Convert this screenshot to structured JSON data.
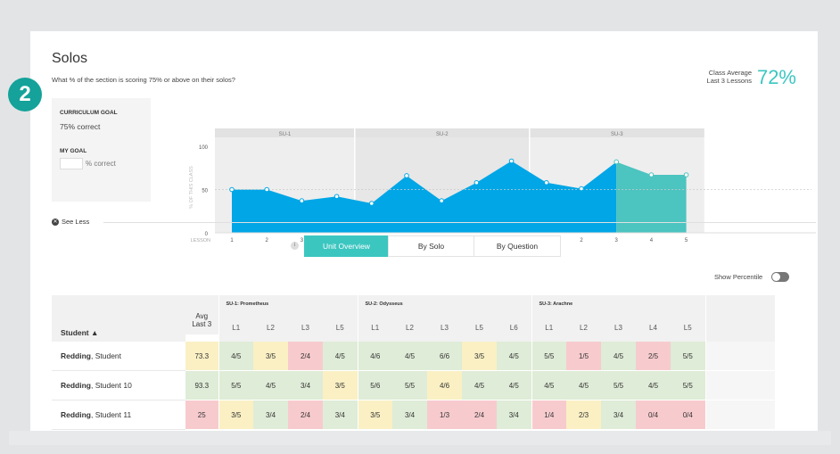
{
  "header": {
    "title": "Solos",
    "subtitle": "What % of the section is scoring 75% or above on their solos?",
    "class_average_line1": "Class Average",
    "class_average_line2": "Last 3 Lessons",
    "class_average_value": "72%"
  },
  "step_badge": "2",
  "goals": {
    "curriculum_goal_title": "CURRICULUM GOAL",
    "curriculum_goal_value": "75% correct",
    "my_goal_title": "MY GOAL",
    "my_goal_value": "",
    "my_goal_suffix": "% correct"
  },
  "chart_data": {
    "type": "area",
    "ylabel": "% OF THIS CLASS",
    "xlabel": "LESSON",
    "ylim": [
      0,
      100
    ],
    "yticks": [
      "100",
      "50",
      "0"
    ],
    "goal_line": 50,
    "units": [
      {
        "name": "SU-1",
        "lessons": [
          "1",
          "2",
          "3",
          "5"
        ],
        "values": [
          50,
          50,
          37,
          42
        ]
      },
      {
        "name": "SU-2",
        "lessons": [
          "1",
          "2",
          "3",
          "5",
          "6"
        ],
        "values": [
          34,
          66,
          37,
          58,
          83
        ]
      },
      {
        "name": "SU-3",
        "lessons": [
          "1",
          "2",
          "3",
          "4",
          "5"
        ],
        "values": [
          58,
          51,
          82,
          67,
          67
        ]
      }
    ],
    "highlight_last_lessons": 3,
    "colors": {
      "series": "#00a6e6",
      "highlight": "#4cc4c0",
      "band_a": "#eeeeee",
      "band_b": "#e7e7e7"
    }
  },
  "see_less": "See Less",
  "tabs": [
    {
      "label": "Unit Overview",
      "active": true
    },
    {
      "label": "By Solo",
      "active": false
    },
    {
      "label": "By Question",
      "active": false
    }
  ],
  "show_percentile": "Show Percentile",
  "table": {
    "student_header": "Student ▲",
    "avg_header_line1": "Avg",
    "avg_header_line2": "Last 3",
    "groups": [
      {
        "name": "SU-1: Prometheus",
        "lessons": [
          "L1",
          "L2",
          "L3",
          "L5"
        ]
      },
      {
        "name": "SU-2: Odysseus",
        "lessons": [
          "L1",
          "L2",
          "L3",
          "L5",
          "L6"
        ]
      },
      {
        "name": "SU-3: Arachne",
        "lessons": [
          "L1",
          "L2",
          "L3",
          "L4",
          "L5"
        ]
      }
    ],
    "rows": [
      {
        "last": "Redding",
        "first": ", Student",
        "avg": {
          "v": "73.3",
          "c": "y"
        },
        "cells": [
          {
            "v": "4/5",
            "c": "g"
          },
          {
            "v": "3/5",
            "c": "y"
          },
          {
            "v": "2/4",
            "c": "r"
          },
          {
            "v": "4/5",
            "c": "g"
          },
          {
            "v": "4/6",
            "c": "g"
          },
          {
            "v": "4/5",
            "c": "g"
          },
          {
            "v": "6/6",
            "c": "g"
          },
          {
            "v": "3/5",
            "c": "y"
          },
          {
            "v": "4/5",
            "c": "g"
          },
          {
            "v": "5/5",
            "c": "g"
          },
          {
            "v": "1/5",
            "c": "r"
          },
          {
            "v": "4/5",
            "c": "g"
          },
          {
            "v": "2/5",
            "c": "r"
          },
          {
            "v": "5/5",
            "c": "g"
          }
        ]
      },
      {
        "last": "Redding",
        "first": ", Student 10",
        "avg": {
          "v": "93.3",
          "c": "g"
        },
        "cells": [
          {
            "v": "5/5",
            "c": "g"
          },
          {
            "v": "4/5",
            "c": "g"
          },
          {
            "v": "3/4",
            "c": "g"
          },
          {
            "v": "3/5",
            "c": "y"
          },
          {
            "v": "5/6",
            "c": "g"
          },
          {
            "v": "5/5",
            "c": "g"
          },
          {
            "v": "4/6",
            "c": "y"
          },
          {
            "v": "4/5",
            "c": "g"
          },
          {
            "v": "4/5",
            "c": "g"
          },
          {
            "v": "4/5",
            "c": "g"
          },
          {
            "v": "4/5",
            "c": "g"
          },
          {
            "v": "5/5",
            "c": "g"
          },
          {
            "v": "4/5",
            "c": "g"
          },
          {
            "v": "5/5",
            "c": "g"
          }
        ]
      },
      {
        "last": "Redding",
        "first": ", Student 11",
        "avg": {
          "v": "25",
          "c": "r"
        },
        "cells": [
          {
            "v": "3/5",
            "c": "y"
          },
          {
            "v": "3/4",
            "c": "g"
          },
          {
            "v": "2/4",
            "c": "r"
          },
          {
            "v": "3/4",
            "c": "g"
          },
          {
            "v": "3/5",
            "c": "y"
          },
          {
            "v": "3/4",
            "c": "g"
          },
          {
            "v": "1/3",
            "c": "r"
          },
          {
            "v": "2/4",
            "c": "r"
          },
          {
            "v": "3/4",
            "c": "g"
          },
          {
            "v": "1/4",
            "c": "r"
          },
          {
            "v": "2/3",
            "c": "y"
          },
          {
            "v": "3/4",
            "c": "g"
          },
          {
            "v": "0/4",
            "c": "r"
          },
          {
            "v": "0/4",
            "c": "r"
          }
        ]
      }
    ]
  }
}
